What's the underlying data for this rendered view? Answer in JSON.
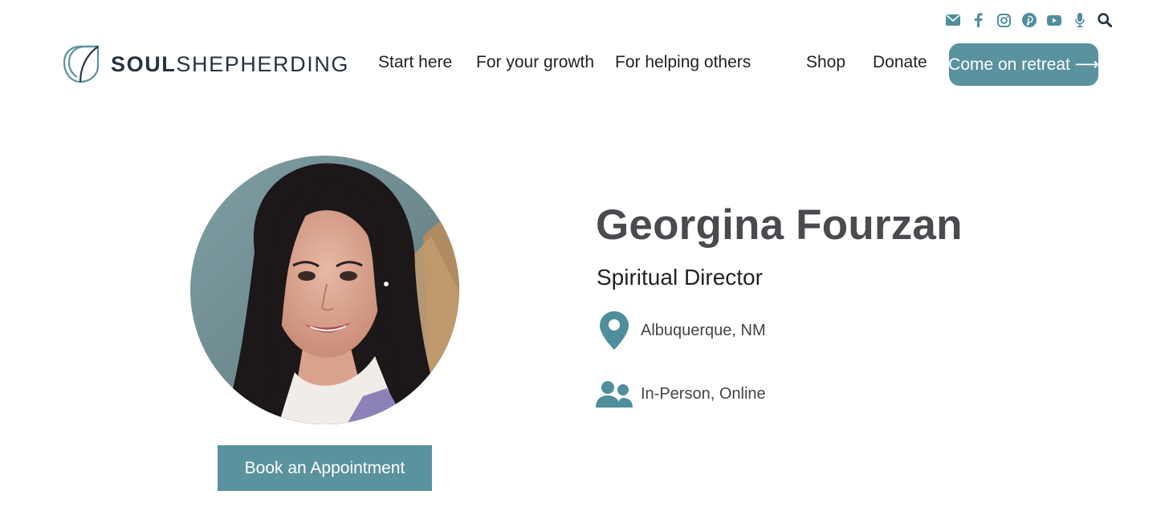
{
  "social": {
    "icons": [
      "envelope-icon",
      "facebook-icon",
      "instagram-icon",
      "pinterest-icon",
      "youtube-icon",
      "microphone-icon",
      "search-icon"
    ]
  },
  "brand": {
    "name_bold": "SOUL",
    "name_light": "SHEPHERDING"
  },
  "nav": {
    "items": [
      "Start here",
      "For your growth",
      "For helping others",
      "Shop",
      "Donate"
    ],
    "cta": "Come on retreat ⟶"
  },
  "profile": {
    "name": "Georgina Fourzan",
    "role": "Spiritual Director",
    "location": "Albuquerque, NM",
    "session_types": "In-Person, Online",
    "book_button": "Book an Appointment"
  },
  "colors": {
    "accent": "#5a929e",
    "icon": "#4f8e9c",
    "heading": "#4a4a4f",
    "brand_text": "#253341"
  }
}
